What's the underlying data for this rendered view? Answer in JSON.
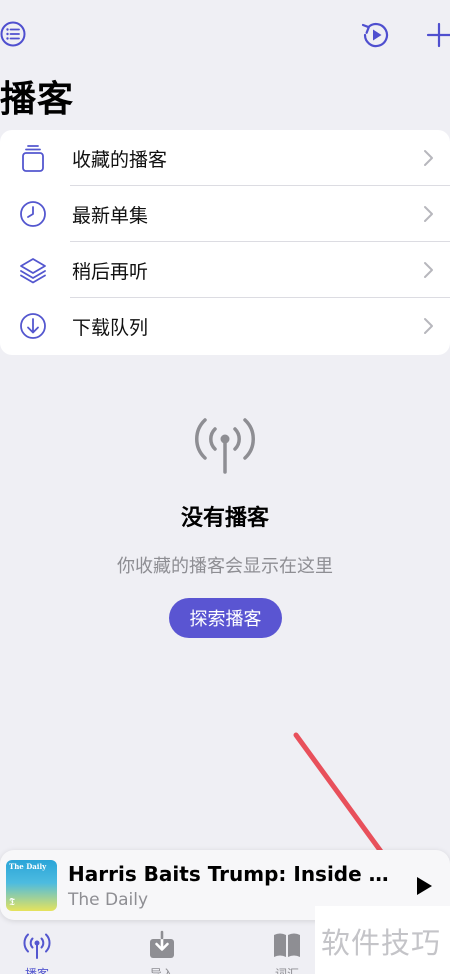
{
  "header": {
    "title": "播客",
    "menu_icon": "list-circle-icon",
    "history_icon": "play-history-icon",
    "add_icon": "plus-icon"
  },
  "list": {
    "items": [
      {
        "label": "收藏的播客",
        "icon": "collection-icon"
      },
      {
        "label": "最新单集",
        "icon": "clock-icon"
      },
      {
        "label": "稍后再听",
        "icon": "layers-icon"
      },
      {
        "label": "下载队列",
        "icon": "download-circle-icon"
      }
    ]
  },
  "empty_state": {
    "icon": "broadcast-antenna-icon",
    "title": "没有播客",
    "subtitle": "你收藏的播客会显示在这里",
    "button_label": "探索播客"
  },
  "player": {
    "artwork_title": "The Daily",
    "artwork_logo": "𝕿",
    "episode_title": "Harris Baits Trump: Inside Their...",
    "show_name": "The Daily",
    "play_icon": "play-icon"
  },
  "tabbar": {
    "tabs": [
      {
        "label": "播客",
        "icon": "broadcast-icon",
        "active": true
      },
      {
        "label": "导入",
        "icon": "import-tray-icon",
        "active": false
      },
      {
        "label": "词汇",
        "icon": "book-icon",
        "active": false
      }
    ]
  },
  "watermark": {
    "text": "软件技巧"
  },
  "colors": {
    "accent": "#5a55d2",
    "background": "#efeff4",
    "annotation": "#e8505b"
  }
}
